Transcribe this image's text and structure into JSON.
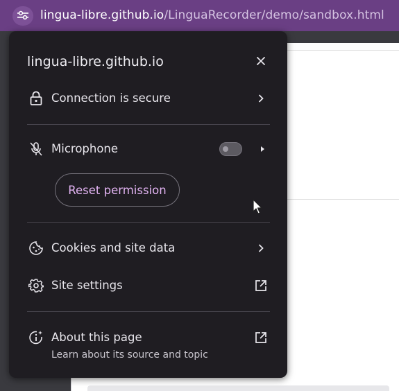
{
  "address_bar": {
    "host": "lingua-libre.github.io",
    "path": "/LinguaRecorder/demo/sandbox.html"
  },
  "popup": {
    "title": "lingua-libre.github.io",
    "connection_label": "Connection is secure",
    "microphone_label": "Microphone",
    "microphone_enabled": false,
    "reset_permission_label": "Reset permission",
    "cookies_label": "Cookies and site data",
    "site_settings_label": "Site settings",
    "about_label": "About this page",
    "about_sublabel": "Learn about its source and topic"
  },
  "colors": {
    "address_bar_bg": "#6a3f84",
    "popup_bg": "#1f1d22",
    "accent": "#e2b3f2"
  },
  "icons": {
    "site_info": "tune-icon",
    "close": "close-icon",
    "connection": "lock-icon",
    "microphone": "microphone-off-icon",
    "cookies": "cookie-icon",
    "site_settings": "gear-icon",
    "about": "info-sparkle-icon",
    "external": "open-in-new-icon"
  }
}
